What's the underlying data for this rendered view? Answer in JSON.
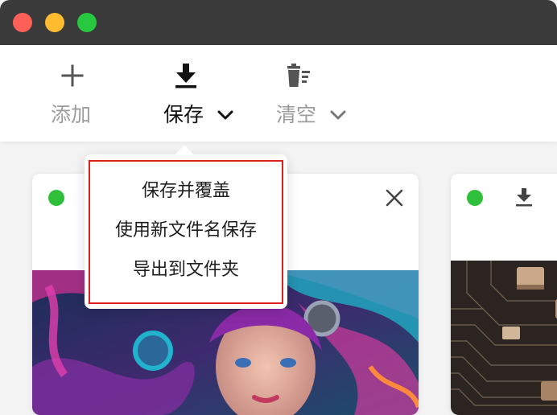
{
  "window": {
    "traffic_lights": [
      "close",
      "minimize",
      "maximize"
    ]
  },
  "toolbar": {
    "add": {
      "label": "添加",
      "icon": "plus-icon"
    },
    "save": {
      "label": "保存",
      "icon": "download-icon",
      "has_menu": true
    },
    "clear": {
      "label": "清空",
      "icon": "trash-icon",
      "has_menu": true
    }
  },
  "save_menu": {
    "items": [
      "保存并覆盖",
      "使用新文件名保存",
      "导出到文件夹"
    ]
  },
  "cards": [
    {
      "status": "ready",
      "action_icon": "close-icon",
      "image": "fantasy-portrait-colorful-hair"
    },
    {
      "status": "ready",
      "action_icon": "download-icon",
      "image": "circuit-board-closeup"
    }
  ],
  "colors": {
    "status_green": "#2fbf3a",
    "highlight_red": "#e0201e",
    "titlebar": "#3a3a3a"
  }
}
